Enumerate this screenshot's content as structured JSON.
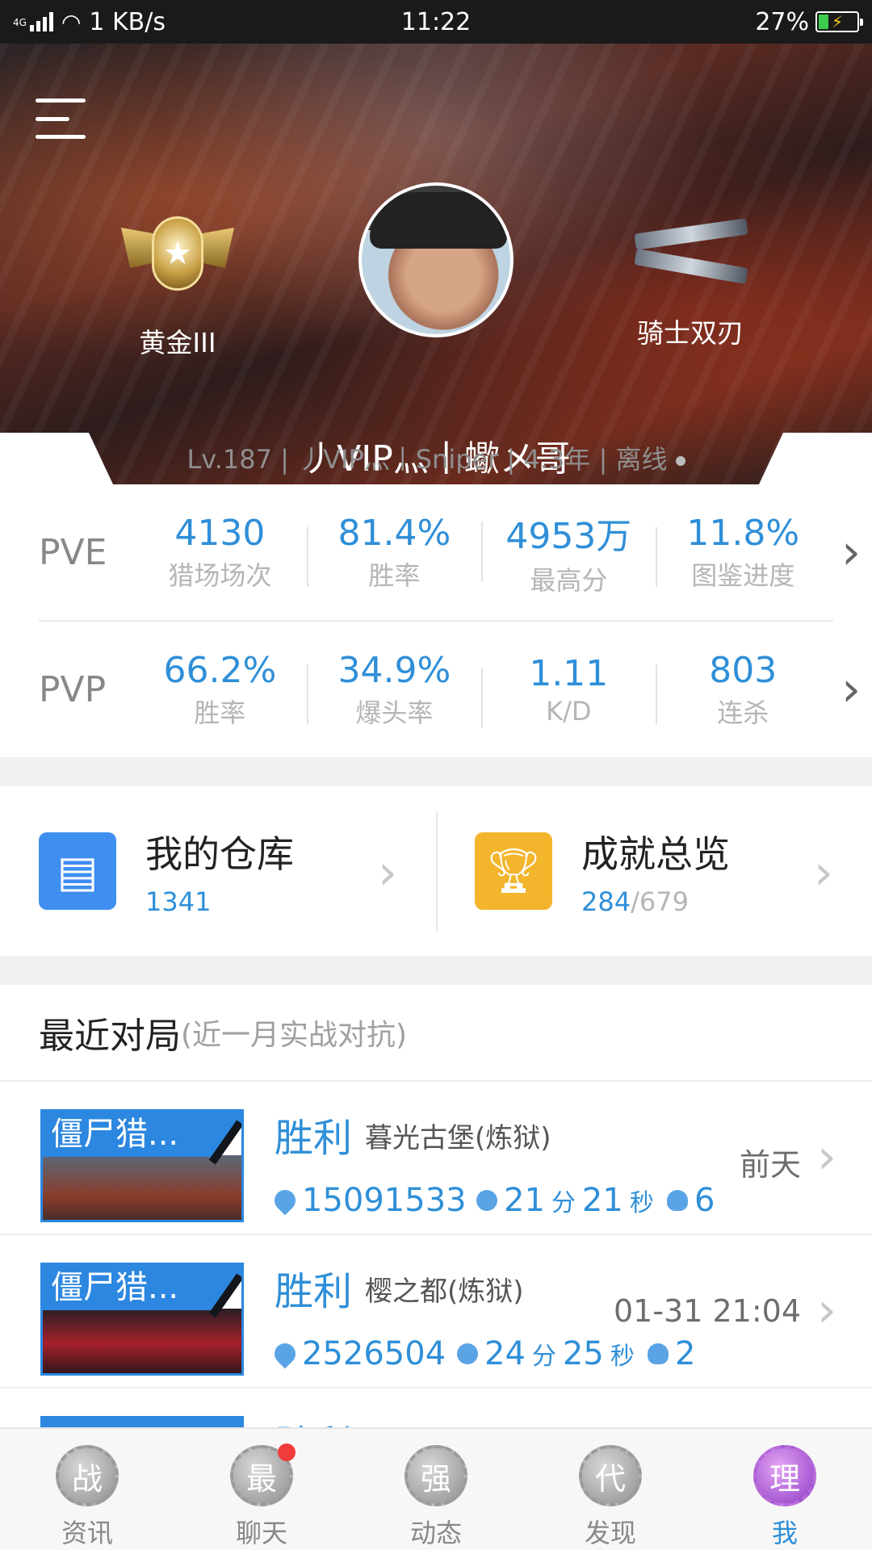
{
  "status_bar": {
    "network": "4G",
    "speed": "1 KB/s",
    "time": "11:22",
    "battery": "27%",
    "battery_level": 0.27
  },
  "profile": {
    "rank_name": "黄金III",
    "rank_badge_text": "III",
    "weapon_name": "骑士双刃",
    "nickname": "丿VIP灬丨蠍メ哥",
    "subinfo": "Lv.187 | 丿VIP灬丨Sniper | 4.3年 |  离线"
  },
  "stats": {
    "pve": {
      "label": "PVE",
      "items": [
        {
          "value": "4130",
          "label": "猎场场次"
        },
        {
          "value": "81.4%",
          "label": "胜率"
        },
        {
          "value": "4953万",
          "label": "最高分"
        },
        {
          "value": "11.8%",
          "label": "图鉴进度"
        }
      ]
    },
    "pvp": {
      "label": "PVP",
      "items": [
        {
          "value": "66.2%",
          "label": "胜率"
        },
        {
          "value": "34.9%",
          "label": "爆头率"
        },
        {
          "value": "1.11",
          "label": "K/D"
        },
        {
          "value": "803",
          "label": "连杀"
        }
      ]
    }
  },
  "cards": {
    "warehouse": {
      "title": "我的仓库",
      "count": "1341"
    },
    "achievements": {
      "title": "成就总览",
      "done": "284",
      "total": "/679"
    }
  },
  "recent": {
    "title": "最近对局",
    "subtitle": "(近一月实战对抗)",
    "matches": [
      {
        "mode": "僵尸猎...",
        "result": "胜利",
        "map": "暮光古堡(炼狱)",
        "time": "前天",
        "score": "15091533",
        "minutes": "21",
        "min_unit": "分",
        "seconds": "21",
        "sec_unit": "秒",
        "deaths": "6"
      },
      {
        "mode": "僵尸猎...",
        "result": "胜利",
        "map": "樱之都(炼狱)",
        "time": "01-31 21:04",
        "score": "2526504",
        "minutes": "24",
        "min_unit": "分",
        "seconds": "25",
        "sec_unit": "秒",
        "deaths": "2"
      },
      {
        "mode": "",
        "result": "胜利",
        "map": "",
        "time": "",
        "score": "",
        "minutes": "",
        "min_unit": "",
        "seconds": "",
        "sec_unit": "",
        "deaths": ""
      }
    ]
  },
  "nav": {
    "items": [
      {
        "icon_char": "战",
        "label": "资讯"
      },
      {
        "icon_char": "最",
        "label": "聊天"
      },
      {
        "icon_char": "强",
        "label": "动态"
      },
      {
        "icon_char": "代",
        "label": "发现"
      },
      {
        "icon_char": "理",
        "label": "我"
      }
    ]
  },
  "colors": {
    "accent": "#2f8fd8",
    "warehouse_icon": "#3e8ff0",
    "achievement_icon": "#f3b52c",
    "notification_dot": "#f23b3b"
  },
  "icons": {
    "menu": "menu-icon",
    "warehouse": "warehouse-icon",
    "achievement": "trophy-icon",
    "score": "medal-icon",
    "duration": "timer-icon",
    "deaths": "skull-icon"
  }
}
